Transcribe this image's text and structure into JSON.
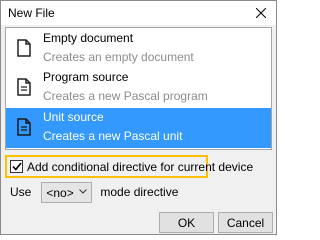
{
  "window": {
    "title": "New File"
  },
  "items": [
    {
      "name": "Empty document",
      "description": "Creates an empty document",
      "icon": "document-icon",
      "selected": false
    },
    {
      "name": "Program source",
      "description": "Creates a new Pascal program",
      "icon": "text-document-icon",
      "selected": false
    },
    {
      "name": "Unit source",
      "description": "Creates a new Pascal unit",
      "icon": "text-document-icon",
      "selected": true
    }
  ],
  "options": {
    "conditional_label": "Add conditional directive for current device",
    "conditional_checked": true,
    "use_label": "Use",
    "mode_value": "<no>",
    "mode_label": "mode directive"
  },
  "buttons": {
    "ok": "OK",
    "cancel": "Cancel"
  },
  "colors": {
    "selection": "#3399ff",
    "highlight_border": "#ffc000"
  }
}
